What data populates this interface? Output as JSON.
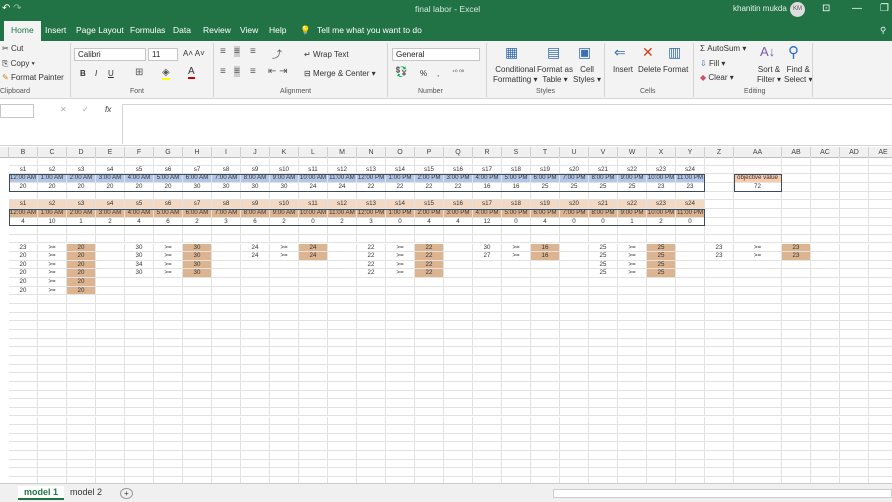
{
  "window": {
    "title": "final labor  -  Excel",
    "user": "khanitin mukda",
    "avatar": "KM"
  },
  "tabs": [
    "Home",
    "Insert",
    "Page Layout",
    "Formulas",
    "Data",
    "Review",
    "View",
    "Help"
  ],
  "tell_me": "Tell me what you want to do",
  "ribbon": {
    "clipboard": {
      "cut": "Cut",
      "copy": "Copy",
      "format_painter": "Format Painter",
      "label": "Clipboard"
    },
    "font": {
      "name": "Calibri",
      "size": "11",
      "bold": "B",
      "italic": "I",
      "underline": "U",
      "label": "Font"
    },
    "alignment": {
      "wrap": "Wrap Text",
      "merge": "Merge & Center",
      "label": "Alignment"
    },
    "number": {
      "format": "General",
      "percent": "%",
      "comma": ",",
      "label": "Number"
    },
    "styles": {
      "cond1": "Conditional",
      "cond2": "Formatting",
      "fmt1": "Format as",
      "fmt2": "Table",
      "cell1": "Cell",
      "cell2": "Styles",
      "label": "Styles"
    },
    "cells": {
      "insert": "Insert",
      "delete": "Delete",
      "format": "Format",
      "label": "Cells"
    },
    "editing": {
      "autosum": "AutoSum",
      "fill": "Fill",
      "clear": "Clear",
      "sort1": "Sort &",
      "sort2": "Filter",
      "find1": "Find &",
      "find2": "Select",
      "label": "Editing"
    }
  },
  "formula_bar": {
    "cancel": "✕",
    "enter": "✓",
    "fx": "fx",
    "value": ""
  },
  "sheet": {
    "columns": [
      "B",
      "C",
      "D",
      "E",
      "F",
      "G",
      "H",
      "I",
      "J",
      "K",
      "L",
      "M",
      "N",
      "O",
      "P",
      "Q",
      "R",
      "S",
      "T",
      "U",
      "V",
      "W",
      "X",
      "Y",
      "Z",
      "AA",
      "AB",
      "AC",
      "AD",
      "AE"
    ],
    "shifts": [
      "s1",
      "s2",
      "s3",
      "s4",
      "s5",
      "s6",
      "s7",
      "s8",
      "s9",
      "s10",
      "s11",
      "s12",
      "s13",
      "s14",
      "s15",
      "s16",
      "s17",
      "s18",
      "s19",
      "s20",
      "s21",
      "s22",
      "s23",
      "s24"
    ],
    "times": [
      "12:00 AM",
      "1:00 AM",
      "2:00 AM",
      "3:00 AM",
      "4:00 AM",
      "5:00 AM",
      "6:00 AM",
      "7:00 AM",
      "8:00 AM",
      "9:00 AM",
      "10:00 AM",
      "11:00 AM",
      "12:00 PM",
      "1:00 PM",
      "2:00 PM",
      "3:00 PM",
      "4:00 PM",
      "5:00 PM",
      "6:00 PM",
      "7:00 PM",
      "8:00 PM",
      "9:00 PM",
      "10:00 PM",
      "11:00 PM"
    ],
    "requirements": [
      "20",
      "20",
      "20",
      "20",
      "20",
      "20",
      "30",
      "30",
      "30",
      "30",
      "24",
      "24",
      "22",
      "22",
      "22",
      "22",
      "16",
      "16",
      "25",
      "25",
      "25",
      "25",
      "23",
      "23"
    ],
    "workers": [
      "4",
      "10",
      "1",
      "2",
      "4",
      "6",
      "2",
      "3",
      "6",
      "2",
      "0",
      "2",
      "3",
      "0",
      "4",
      "4",
      "12",
      "0",
      "4",
      "0",
      "0",
      "1",
      "2",
      "0"
    ],
    "objective": {
      "label": "objective value",
      "value": "72"
    },
    "constraints": [
      {
        "col": 0,
        "lhs": [
          "23",
          "20",
          "20",
          "20",
          "20",
          "20"
        ],
        "op": ">=",
        "rhs": [
          "20",
          "20",
          "20",
          "20",
          "20",
          "20"
        ]
      },
      {
        "col": 4,
        "lhs": [
          "30",
          "30",
          "34",
          "30"
        ],
        "op": ">=",
        "rhs": [
          "30",
          "30",
          "30",
          "30"
        ]
      },
      {
        "col": 8,
        "lhs": [
          "24",
          "24"
        ],
        "op": ">=",
        "rhs": [
          "24",
          "24"
        ]
      },
      {
        "col": 12,
        "lhs": [
          "22",
          "22",
          "22",
          "22"
        ],
        "op": ">=",
        "rhs": [
          "22",
          "22",
          "22",
          "22"
        ]
      },
      {
        "col": 16,
        "lhs": [
          "30",
          "27"
        ],
        "op": ">=",
        "rhs": [
          "16",
          "16"
        ]
      },
      {
        "col": 20,
        "lhs": [
          "25",
          "25",
          "25",
          "25"
        ],
        "op": ">=",
        "rhs": [
          "25",
          "25",
          "25",
          "25"
        ]
      },
      {
        "col": 24,
        "lhs": [
          "23",
          "23"
        ],
        "op": ">=",
        "rhs": [
          "23",
          "23"
        ]
      }
    ],
    "tabs": [
      "model 1",
      "model 2"
    ],
    "add_sheet": "+"
  }
}
